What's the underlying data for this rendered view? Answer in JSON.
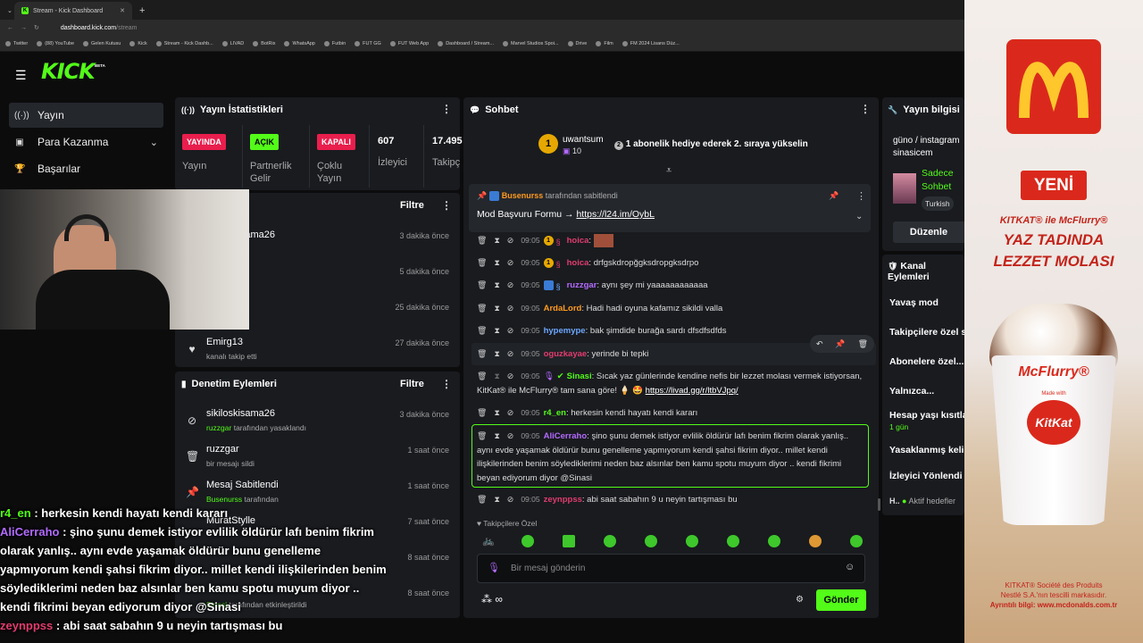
{
  "browser": {
    "tabs": [
      {
        "label": "Stream - Kick Dashboard",
        "active": true
      }
    ],
    "url": {
      "domain": "dashboard.kick.com",
      "path": "/stream"
    },
    "bookmarks": [
      "Twitter",
      "(88) YouTube",
      "Gelen Kutusu",
      "Kick",
      "Stream - Kick Dashb...",
      "LIVAD",
      "BotRix",
      "WhatsApp",
      "Futbin",
      "FUT GG",
      "FUT Web App",
      "Dashboard / Stream...",
      "Marvel Studios Spoi...",
      "Drive",
      "Film",
      "FM 2024 Lisans Düz..."
    ]
  },
  "logo": {
    "text": "KICK",
    "beta": "BETA"
  },
  "sidebar": {
    "items": [
      {
        "label": "Yayın",
        "icon": "broadcast-icon",
        "active": true
      },
      {
        "label": "Para Kazanma",
        "icon": "money-icon",
        "expandable": true
      },
      {
        "label": "Başarılar",
        "icon": "trophy-icon"
      }
    ]
  },
  "stats": {
    "title": "Yayın İstatistikleri",
    "cols": [
      {
        "badge": "YAYINDA",
        "badge_color": "#e91e4c",
        "label": "Yayın"
      },
      {
        "badge": "AÇIK",
        "badge_color": "#53fc18",
        "label": "Partnerlik Gelir"
      },
      {
        "badge": "KAPALI",
        "badge_color": "#e91e4c",
        "label": "Çoklu Yayın"
      },
      {
        "value": "607",
        "label": "İzleyici"
      },
      {
        "value": "17.495",
        "label": "Takipç"
      }
    ]
  },
  "activity": {
    "filter": "Filtre",
    "rows": [
      {
        "name": "sikiloskisama26",
        "sub": "etti",
        "time": "3 dakika önce"
      },
      {
        "name": "nasi",
        "sub": "etti",
        "time": "5 dakika önce"
      },
      {
        "name": "gi",
        "sub": "etti",
        "time": "25 dakika önce"
      },
      {
        "name": "Emirg13",
        "sub": "kanalı takip etti",
        "time": "27 dakika önce"
      }
    ]
  },
  "moderation": {
    "title": "Denetim Eylemleri",
    "filter": "Filtre",
    "rows": [
      {
        "name": "sikiloskisama26",
        "sub_user": "ruzzgar",
        "sub": " tarafından yasaklandı",
        "time": "3 dakika önce",
        "icon": "ban-icon"
      },
      {
        "name": "ruzzgar",
        "sub_user": "",
        "sub": "bir mesajı sildi",
        "time": "1 saat önce",
        "icon": "trash-icon"
      },
      {
        "name": "Mesaj Sabitlendi",
        "sub_user": "Busenurss",
        "sub": " tarafından",
        "time": "1 saat önce",
        "icon": "pin-icon"
      },
      {
        "name": "MuratStylle",
        "sub_user": "",
        "sub": "",
        "time": "7 saat önce",
        "icon": "user-icon"
      },
      {
        "name": "",
        "sub_user": "",
        "sub": "",
        "time": "8 saat önce",
        "icon": "user-icon"
      },
      {
        "name": "",
        "sub_user": "Sinasi",
        "sub": " tarafından etkinleştirildi",
        "time": "8 saat önce",
        "icon": "user-icon"
      }
    ]
  },
  "chat": {
    "title": "Sohbet",
    "gift": {
      "user": "uwantsum",
      "count": "10",
      "text": "1 abonelik hediye ederek 2. sıraya yükselin"
    },
    "pinned": {
      "by": "Busenurss",
      "by_suffix": " tarafından sabitlendi",
      "text": "Mod Başvuru Formu → ",
      "link": "https://l24.im/OybL"
    },
    "messages": [
      {
        "time": "09:05",
        "user": "hoica",
        "color": "#e23c6f",
        "text": ""
      },
      {
        "time": "09:05",
        "user": "hoica",
        "color": "#e23c6f",
        "text": "drfgskdropğgksdropgksdrpo"
      },
      {
        "time": "09:05",
        "user": "ruzzgar",
        "color": "#b36bff",
        "text": "aynı şey mi yaaaaaaaaaaaa"
      },
      {
        "time": "09:05",
        "user": "ArdaLord",
        "color": "#ff9a1f",
        "text": "Hadi hadi oyuna kafamız sikildi valla"
      },
      {
        "time": "09:05",
        "user": "hypemype",
        "color": "#6ea8ff",
        "text": "bak şimdide burağa sardı dfsdfsdfds"
      },
      {
        "time": "09:05",
        "user": "oguzkayae",
        "color": "#e23c6f",
        "text": "yerinde bi tepki"
      },
      {
        "time": "09:05",
        "user": "Sinasi",
        "color": "#53fc18",
        "text": "Sıcak yaz günlerinde kendine nefis bir lezzet molası vermek istiyorsan, KitKat® ile McFlurry® tam sana göre! 🍦 🤩 ",
        "link": "https://livad.gg/r/ltbVJpq/"
      },
      {
        "time": "09:05",
        "user": "r4_en",
        "color": "#53fc18",
        "text": "herkesin kendi hayatı kendi kararı"
      },
      {
        "time": "09:05",
        "user": "AliCerraho",
        "color": "#b36bff",
        "text": "şino şunu demek istiyor evlilik öldürür lafı benim fikrim olarak yanlış.. aynı evde yaşamak öldürür bunu genelleme yapmıyorum kendi şahsi fikrim diyor.. millet kendi ilişkilerinden benim söylediklerimi neden baz alsınlar ben kamu spotu muyum diyor .. kendi fikrimi beyan ediyorum diyor @Sinasi"
      },
      {
        "time": "09:05",
        "user": "zeynppss",
        "color": "#e23c6f",
        "text": "abi saat sabahın 9 u neyin tartışması bu"
      }
    ],
    "followers_only": "Takipçilere Özel",
    "input_placeholder": "Bir mesaj gönderin",
    "points": "∞",
    "send": "Gönder"
  },
  "stream_info": {
    "title": "Yayın bilgisi",
    "stream_title": "güno / instagram sinasicem",
    "category": "Sadece Sohbet",
    "language": "Turkish",
    "edit": "Düzenle"
  },
  "channel_actions": {
    "title": "Kanal Eylemleri",
    "items": [
      "Yavaş mod",
      "Takipçilere özel s",
      "Abonelere özel...",
      "Yalnızca...",
      "Hesap yaşı kısıtla",
      "Yasaklanmış keli",
      "İzleyici Yönlendi"
    ],
    "sub_1gun": "1 gün",
    "footer_h": "H..",
    "footer": "Aktif hedefler"
  },
  "ad": {
    "badge": "YENİ",
    "line1": "KITKAT® ile McFlurry®",
    "line2": "YAZ TADINDA",
    "line3": "LEZZET MOLASI",
    "cup_brand": "McFlurry®",
    "cup_sub": "Made with",
    "cup_logo": "KitKat",
    "legal1": "KITKAT® Société des Produits",
    "legal2": "Nestlé S.A.'nın tescilli markasıdır.",
    "legal3": "Ayrıntılı bilgi: www.mcdonalds.com.tr"
  },
  "overlay": {
    "lines": [
      {
        "user": "r4_en",
        "color": "#53fc18",
        "text": " : herkesin kendi hayatı kendi kararı"
      },
      {
        "user": "AliCerraho",
        "color": "#b36bff",
        "text": " : şino şunu demek istiyor evlilik öldürür lafı benim fikrim"
      },
      {
        "user": "",
        "color": "#fff",
        "text": "olarak yanlış.. aynı evde yaşamak öldürür bunu genelleme"
      },
      {
        "user": "",
        "color": "#fff",
        "text": "yapmıyorum kendi şahsi fikrim diyor.. millet kendi ilişkilerinden benim"
      },
      {
        "user": "",
        "color": "#fff",
        "text": "söylediklerimi neden baz alsınlar ben kamu spotu muyum diyor .."
      },
      {
        "user": "",
        "color": "#fff",
        "text": "kendi fikrimi beyan ediyorum diyor @Sinasi"
      },
      {
        "user": "zeynppss",
        "color": "#e23c6f",
        "text": " : abi saat sabahın 9 u neyin tartışması bu"
      }
    ]
  },
  "colors": {
    "accent": "#53fc18",
    "panel": "#191b1f",
    "mcred": "#da291c",
    "mcyellow": "#ffc72c"
  }
}
